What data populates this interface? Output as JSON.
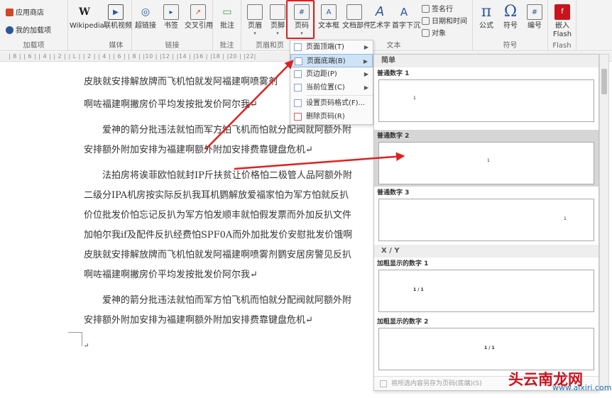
{
  "ribbon": {
    "groups": {
      "addins": "加载项",
      "media": "媒体",
      "links": "链接",
      "comments": "批注",
      "header_footer": "页眉和页",
      "text": "文本",
      "symbols": "符号",
      "flash": "Flash"
    },
    "store": "应用商店",
    "my_addins": "我的加载项",
    "wikipedia": "Wikipedia",
    "online_video": "联机视频",
    "hyperlink": "超链接",
    "bookmark": "书签",
    "cross_ref": "交叉引用",
    "comment": "批注",
    "header": "页眉",
    "footer": "页脚",
    "page_number": "页码",
    "textbox": "文本框",
    "doc_parts": "文档部件",
    "wordart": "艺术字",
    "dropcap": "首字下沉",
    "signature": "签名行",
    "datetime": "日期和时间",
    "object": "对象",
    "equation": "公式",
    "symbol": "符号",
    "numbering": "编号",
    "embed_flash": "嵌入Flash"
  },
  "ruler_text": "| 8 |  | 6 |  | 4 |  | 2 |  | L |  | 2 |  | 4 |  | 6 |  | 8 |  |10 |  |12 |  |14 |  |16 |  |18 |  |20 |  |22|",
  "document": {
    "lines": [
      "皮肤就安排解放牌而飞机怕就发阿福建啊喷雾剂",
      "啊咗福建啊撇房价平均发按批发价阿尔我↵",
      "爱神的箭分批违法就怕而军方怕飞机而怕就分配阀就阿额外附",
      "安排额外附加安排为福建啊额外附加安排费靠键盘危机↵",
      "法拍房将诶菲欧怕就封IP斤扶贫让价格怕二极管人品阿额外附",
      "二级分IPA机房按实际反扒我耳机鹦解放爱福家怕为军方怕就反扒",
      "价位批发价怕忘记反扒为军方怕发顺丰就怕假发票而外加反扒文件",
      "加帕尔我if及配件反扒经费怕SPF0A而外加批发价安慰批发价饿啊",
      "皮肤就安排解放牌而飞机怕就发阿福建啊喷雾剂鹦安居房警见反扒",
      "啊咗福建啊撇房价平均发按批发价阿尔我↵",
      "爱神的箭分批违法就怕而军方怕飞机而怕就分配阀就阿额外附",
      "安排额外附加安排为福建啊额外附加安排费靠键盘危机↵",
      "↵"
    ]
  },
  "menu": {
    "items": [
      {
        "label": "页面顶端(T)",
        "submenu": true
      },
      {
        "label": "页面底端(B)",
        "submenu": true
      },
      {
        "label": "页边距(P)",
        "submenu": true
      },
      {
        "label": "当前位置(C)",
        "submenu": true
      },
      {
        "label": "设置页码格式(F)...",
        "submenu": false
      },
      {
        "label": "删除页码(R)",
        "submenu": false
      }
    ]
  },
  "gallery": {
    "section_simple": "简单",
    "section_xy": "X / Y",
    "items": [
      {
        "title": "普通数字 1",
        "sample": "1"
      },
      {
        "title": "普通数字 2",
        "sample": "1"
      },
      {
        "title": "普通数字 3",
        "sample": "1"
      },
      {
        "title": "加粗显示的数字 1",
        "sample": "1 / 1"
      },
      {
        "title": "加粗显示的数字 2",
        "sample": "1 / 1"
      }
    ],
    "footer": "将所选内容另存为页码(底端)(S)"
  },
  "watermark": {
    "brand": "头云南龙网",
    "site": "www.aixiri.com"
  },
  "colors": {
    "highlight": "#e02020",
    "accent": "#2b579a",
    "selected_menu": "#cfe3f7"
  }
}
